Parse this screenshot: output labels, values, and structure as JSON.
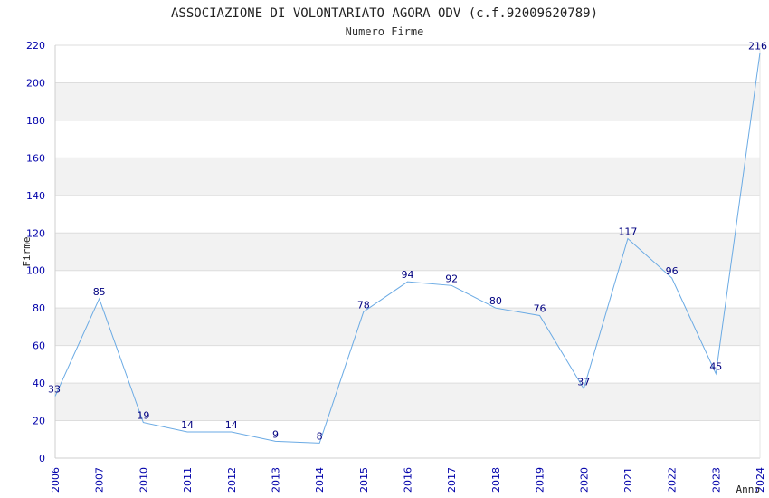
{
  "chart_data": {
    "type": "line",
    "title": "ASSOCIAZIONE DI VOLONTARIATO AGORA ODV (c.f.92009620789)",
    "subtitle": "Numero Firme",
    "xlabel": "Anno",
    "ylabel": "Firme",
    "categories": [
      "2006",
      "2007",
      "2010",
      "2011",
      "2012",
      "2013",
      "2014",
      "2015",
      "2016",
      "2017",
      "2018",
      "2019",
      "2020",
      "2021",
      "2022",
      "2023",
      "2024"
    ],
    "values": [
      33,
      85,
      19,
      14,
      14,
      9,
      8,
      78,
      94,
      92,
      80,
      76,
      37,
      117,
      96,
      45,
      216
    ],
    "ylim": [
      0,
      220
    ],
    "yticks": [
      0,
      20,
      40,
      60,
      80,
      100,
      120,
      140,
      160,
      180,
      200,
      220
    ],
    "grid": true,
    "line_color": "#6aaae4",
    "band_color": "#f2f2f2",
    "tick_color": "#0000aa",
    "label_color": "#000080"
  }
}
